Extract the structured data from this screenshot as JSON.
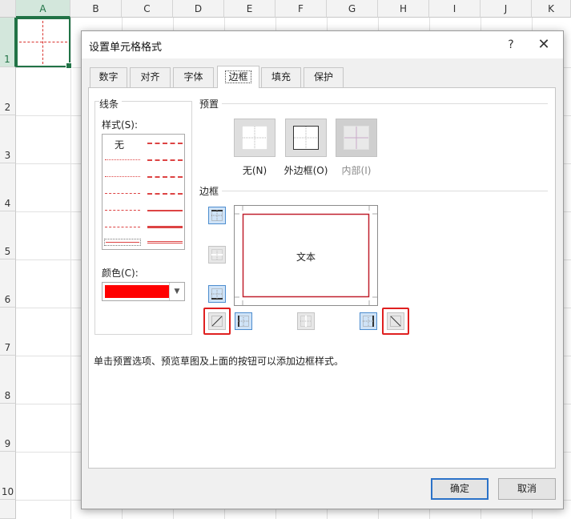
{
  "sheet": {
    "columns": [
      "A",
      "B",
      "C",
      "D",
      "E",
      "F",
      "G",
      "H",
      "I",
      "J",
      "K"
    ],
    "rows": [
      "1",
      "2",
      "3",
      "4",
      "5",
      "6",
      "7",
      "8",
      "9",
      "10"
    ],
    "selected_cell": "A1"
  },
  "dialog": {
    "title": "设置单元格格式",
    "help_label": "?",
    "close_label": "✕",
    "tabs": [
      {
        "label": "数字"
      },
      {
        "label": "对齐"
      },
      {
        "label": "字体"
      },
      {
        "label": "边框",
        "active": true
      },
      {
        "label": "填充"
      },
      {
        "label": "保护"
      }
    ],
    "line": {
      "group_label": "线条",
      "style_label": "样式(S):",
      "style_none": "无",
      "color_label": "颜色(C):",
      "color_value": "#ff0000"
    },
    "presets": {
      "group_label": "预置",
      "items": [
        {
          "label": "无(N)"
        },
        {
          "label": "外边框(O)"
        },
        {
          "label": "内部(I)",
          "disabled": true
        }
      ]
    },
    "border": {
      "group_label": "边框",
      "preview_text": "文本",
      "line_color": "#c0202e"
    },
    "hint": "单击预置选项、预览草图及上面的按钮可以添加边框样式。",
    "ok_label": "确定",
    "cancel_label": "取消"
  }
}
